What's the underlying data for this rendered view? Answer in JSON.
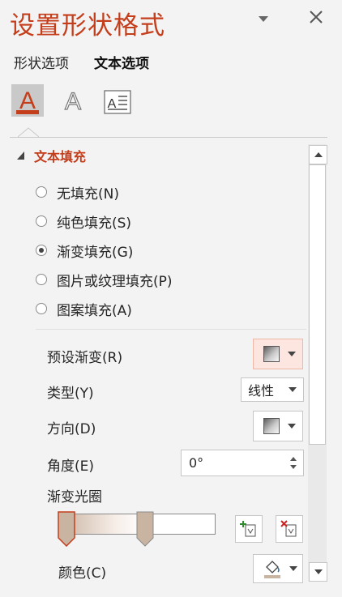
{
  "pane": {
    "title": "设置形状格式",
    "tabs": [
      {
        "label": "形状选项",
        "active": false
      },
      {
        "label": "文本选项",
        "active": true
      }
    ],
    "icon_tabs": [
      {
        "icon": "text-fill-outline-icon",
        "active": true
      },
      {
        "icon": "text-effects-icon",
        "active": false
      },
      {
        "icon": "text-box-icon",
        "active": false
      }
    ]
  },
  "section": {
    "title": "文本填充",
    "fill_options": [
      {
        "label": "无填充(N)",
        "checked": false
      },
      {
        "label": "纯色填充(S)",
        "checked": false
      },
      {
        "label": "渐变填充(G)",
        "checked": true
      },
      {
        "label": "图片或纹理填充(P)",
        "checked": false
      },
      {
        "label": "图案填充(A)",
        "checked": false
      }
    ],
    "preset_gradient_label": "预设渐变(R)",
    "type_label": "类型(Y)",
    "type_value": "线性",
    "direction_label": "方向(D)",
    "angle_label": "角度(E)",
    "angle_value": "0°",
    "stops_label": "渐变光圈",
    "color_label": "颜色(C)"
  },
  "gradient": {
    "stops": [
      {
        "position": 0.05,
        "color": "#c9b4a2",
        "selected": true
      },
      {
        "position": 0.55,
        "color": "#c9b4a2",
        "selected": false
      }
    ]
  },
  "colors": {
    "accent": "#c43e1c",
    "panel_bg": "#f3f3f3",
    "preset_highlight": "#fde6df"
  }
}
